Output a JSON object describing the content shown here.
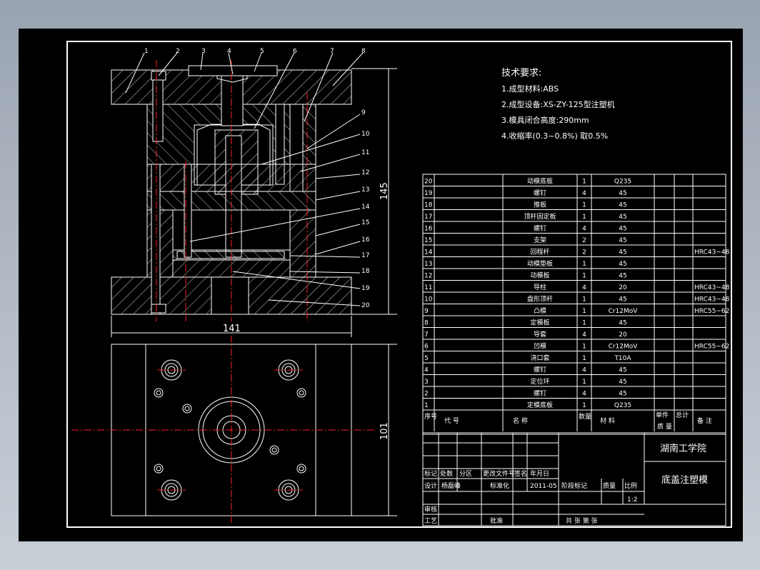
{
  "tech_requirements": {
    "title": "技术要求:",
    "items": [
      "1.成型材料:ABS",
      "2.成型设备:XS-ZY-125型注塑机",
      "3.模具闭合高度:290mm",
      "4.收缩率(0.3~0.8%) 取0.5%"
    ]
  },
  "dimensions": {
    "height": "145",
    "width": "141",
    "plan_height": "101"
  },
  "callouts": [
    "1",
    "2",
    "3",
    "4",
    "5",
    "6",
    "7",
    "8",
    "9",
    "10",
    "11",
    "12",
    "13",
    "14",
    "15",
    "16",
    "17",
    "18",
    "19",
    "20"
  ],
  "bom_rows": [
    {
      "no": "20",
      "name": "动模底板",
      "qty": "1",
      "material": "Q235",
      "note": ""
    },
    {
      "no": "19",
      "name": "螺钉",
      "qty": "4",
      "material": "45",
      "note": ""
    },
    {
      "no": "18",
      "name": "推板",
      "qty": "1",
      "material": "45",
      "note": ""
    },
    {
      "no": "17",
      "name": "顶杆固定板",
      "qty": "1",
      "material": "45",
      "note": ""
    },
    {
      "no": "16",
      "name": "螺钉",
      "qty": "4",
      "material": "45",
      "note": ""
    },
    {
      "no": "15",
      "name": "支架",
      "qty": "2",
      "material": "45",
      "note": ""
    },
    {
      "no": "14",
      "name": "回程杆",
      "qty": "2",
      "material": "45",
      "note": "HRC43~48"
    },
    {
      "no": "13",
      "name": "动模垫板",
      "qty": "1",
      "material": "45",
      "note": ""
    },
    {
      "no": "12",
      "name": "动模板",
      "qty": "1",
      "material": "45",
      "note": ""
    },
    {
      "no": "11",
      "name": "导柱",
      "qty": "4",
      "material": "20",
      "note": "HRC43~48"
    },
    {
      "no": "10",
      "name": "盘形顶杆",
      "qty": "1",
      "material": "45",
      "note": "HRC43~48"
    },
    {
      "no": "9",
      "name": "凸模",
      "qty": "1",
      "material": "Cr12MoV",
      "note": "HRC55~62"
    },
    {
      "no": "8",
      "name": "定模板",
      "qty": "1",
      "material": "45",
      "note": ""
    },
    {
      "no": "7",
      "name": "导套",
      "qty": "4",
      "material": "20",
      "note": ""
    },
    {
      "no": "6",
      "name": "凹模",
      "qty": "1",
      "material": "Cr12MoV",
      "note": "HRC55~62"
    },
    {
      "no": "5",
      "name": "浇口套",
      "qty": "1",
      "material": "T10A",
      "note": ""
    },
    {
      "no": "4",
      "name": "螺钉",
      "qty": "4",
      "material": "45",
      "note": ""
    },
    {
      "no": "3",
      "name": "定位环",
      "qty": "1",
      "material": "45",
      "note": ""
    },
    {
      "no": "2",
      "name": "螺钉",
      "qty": "4",
      "material": "45",
      "note": ""
    },
    {
      "no": "1",
      "name": "定模底板",
      "qty": "1",
      "material": "Q235",
      "note": ""
    }
  ],
  "bom_header": {
    "no": "序号",
    "code": "代 号",
    "name": "名 称",
    "qty": "数量",
    "material": "材 料",
    "unit_weight": "单件",
    "total_weight": "总计",
    "weight": "质 量",
    "note": "备 注"
  },
  "title_block": {
    "school": "湖南工学院",
    "drawing_title": "底盖注塑模",
    "row_labels": [
      "标记",
      "处数",
      "分区",
      "更改文件号",
      "签名",
      "年月日"
    ],
    "design": "设计",
    "designer": "杨磊峰",
    "standardize": "标准化",
    "date": "2011-05",
    "stage_mark": "阶段标记",
    "weight": "质量",
    "scale_label": "比例",
    "scale": "1:2",
    "review": "审核",
    "process": "工艺",
    "approve": "批准",
    "sheets": "共 张 第 张"
  }
}
